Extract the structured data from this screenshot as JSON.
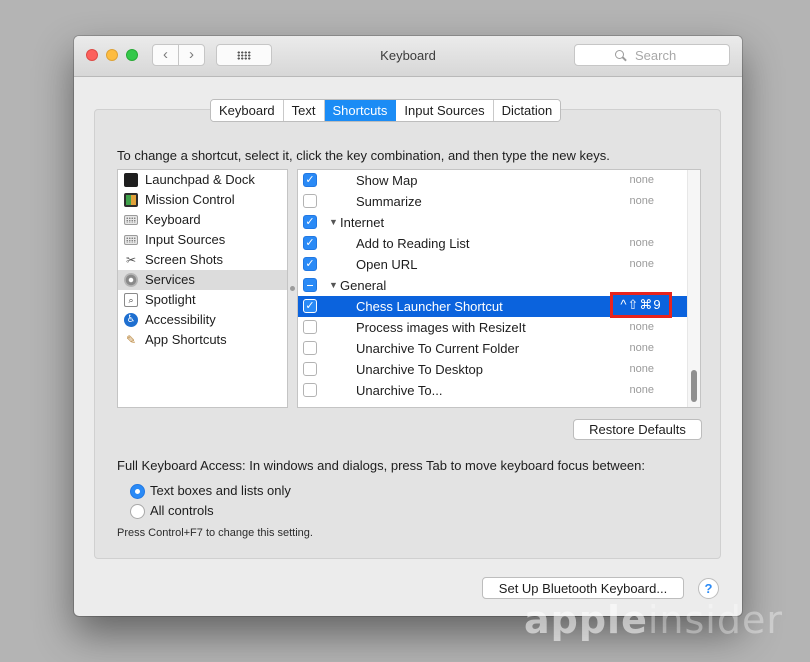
{
  "window": {
    "title": "Keyboard"
  },
  "search": {
    "placeholder": "Search"
  },
  "tabs": [
    {
      "label": "Keyboard",
      "active": false
    },
    {
      "label": "Text",
      "active": false
    },
    {
      "label": "Shortcuts",
      "active": true
    },
    {
      "label": "Input Sources",
      "active": false
    },
    {
      "label": "Dictation",
      "active": false
    }
  ],
  "instruction": "To change a shortcut, select it, click the key combination, and then type the new keys.",
  "categories": [
    {
      "label": "Launchpad & Dock",
      "icon": "launchpad-icon"
    },
    {
      "label": "Mission Control",
      "icon": "mission-control-icon"
    },
    {
      "label": "Keyboard",
      "icon": "keyboard-icon"
    },
    {
      "label": "Input Sources",
      "icon": "input-sources-icon"
    },
    {
      "label": "Screen Shots",
      "icon": "screenshot-icon"
    },
    {
      "label": "Services",
      "icon": "services-gear-icon",
      "selected": true
    },
    {
      "label": "Spotlight",
      "icon": "spotlight-icon"
    },
    {
      "label": "Accessibility",
      "icon": "accessibility-icon"
    },
    {
      "label": "App Shortcuts",
      "icon": "app-shortcuts-icon"
    }
  ],
  "shortcuts": [
    {
      "type": "item",
      "label": "Show Map",
      "checked": true,
      "shortcut": "none"
    },
    {
      "type": "item",
      "label": "Summarize",
      "checked": false,
      "shortcut": "none"
    },
    {
      "type": "group",
      "label": "Internet",
      "state": "checked"
    },
    {
      "type": "item",
      "label": "Add to Reading List",
      "checked": true,
      "shortcut": "none"
    },
    {
      "type": "item",
      "label": "Open URL",
      "checked": true,
      "shortcut": "none"
    },
    {
      "type": "group",
      "label": "General",
      "state": "mixed"
    },
    {
      "type": "item",
      "label": "Chess Launcher Shortcut",
      "checked": true,
      "shortcut": "^⇧⌘9",
      "selected": true,
      "highlighted": true
    },
    {
      "type": "item",
      "label": "Process images with ResizeIt",
      "checked": false,
      "shortcut": "none"
    },
    {
      "type": "item",
      "label": "Unarchive To Current Folder",
      "checked": false,
      "shortcut": "none"
    },
    {
      "type": "item",
      "label": "Unarchive To Desktop",
      "checked": false,
      "shortcut": "none"
    },
    {
      "type": "item",
      "label": "Unarchive To...",
      "checked": false,
      "shortcut": "none"
    }
  ],
  "buttons": {
    "restore": "Restore Defaults",
    "bluetooth": "Set Up Bluetooth Keyboard...",
    "help": "?"
  },
  "full_keyboard_access": {
    "label": "Full Keyboard Access: In windows and dialogs, press Tab to move keyboard focus between:",
    "options": [
      {
        "label": "Text boxes and lists only",
        "selected": true
      },
      {
        "label": "All controls",
        "selected": false
      }
    ],
    "hint": "Press Control+F7 to change this setting."
  },
  "watermark": {
    "part1": "apple",
    "part2": "insider"
  },
  "colors": {
    "accent": "#1b8cf5",
    "selection": "#0b63dd",
    "highlight_box": "#e8241d"
  }
}
